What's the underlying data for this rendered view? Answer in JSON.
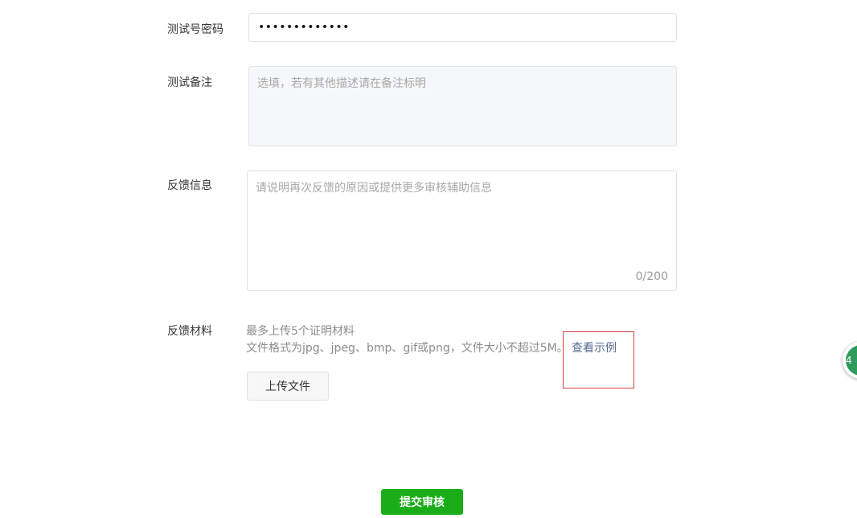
{
  "form": {
    "password": {
      "label": "测试号密码",
      "value": "•••••••••••••"
    },
    "note": {
      "label": "测试备注",
      "placeholder": "选填，若有其他描述请在备注标明"
    },
    "feedback": {
      "label": "反馈信息",
      "placeholder": "请说明再次反馈的原因或提供更多审核辅助信息",
      "counter": "0/200"
    },
    "materials": {
      "label": "反馈材料",
      "hint_line1": "最多上传5个证明材料",
      "hint_line2": "文件格式为jpg、jpeg、bmp、gif或png，文件大小不超过5M。",
      "example_link": "查看示例",
      "upload_button": "上传文件"
    },
    "submit_button": "提交审核"
  },
  "floating_widget": {
    "text": "4"
  },
  "colors": {
    "primary_green": "#1aad19",
    "link_blue": "#576b95",
    "highlight_red": "#d9423c"
  }
}
